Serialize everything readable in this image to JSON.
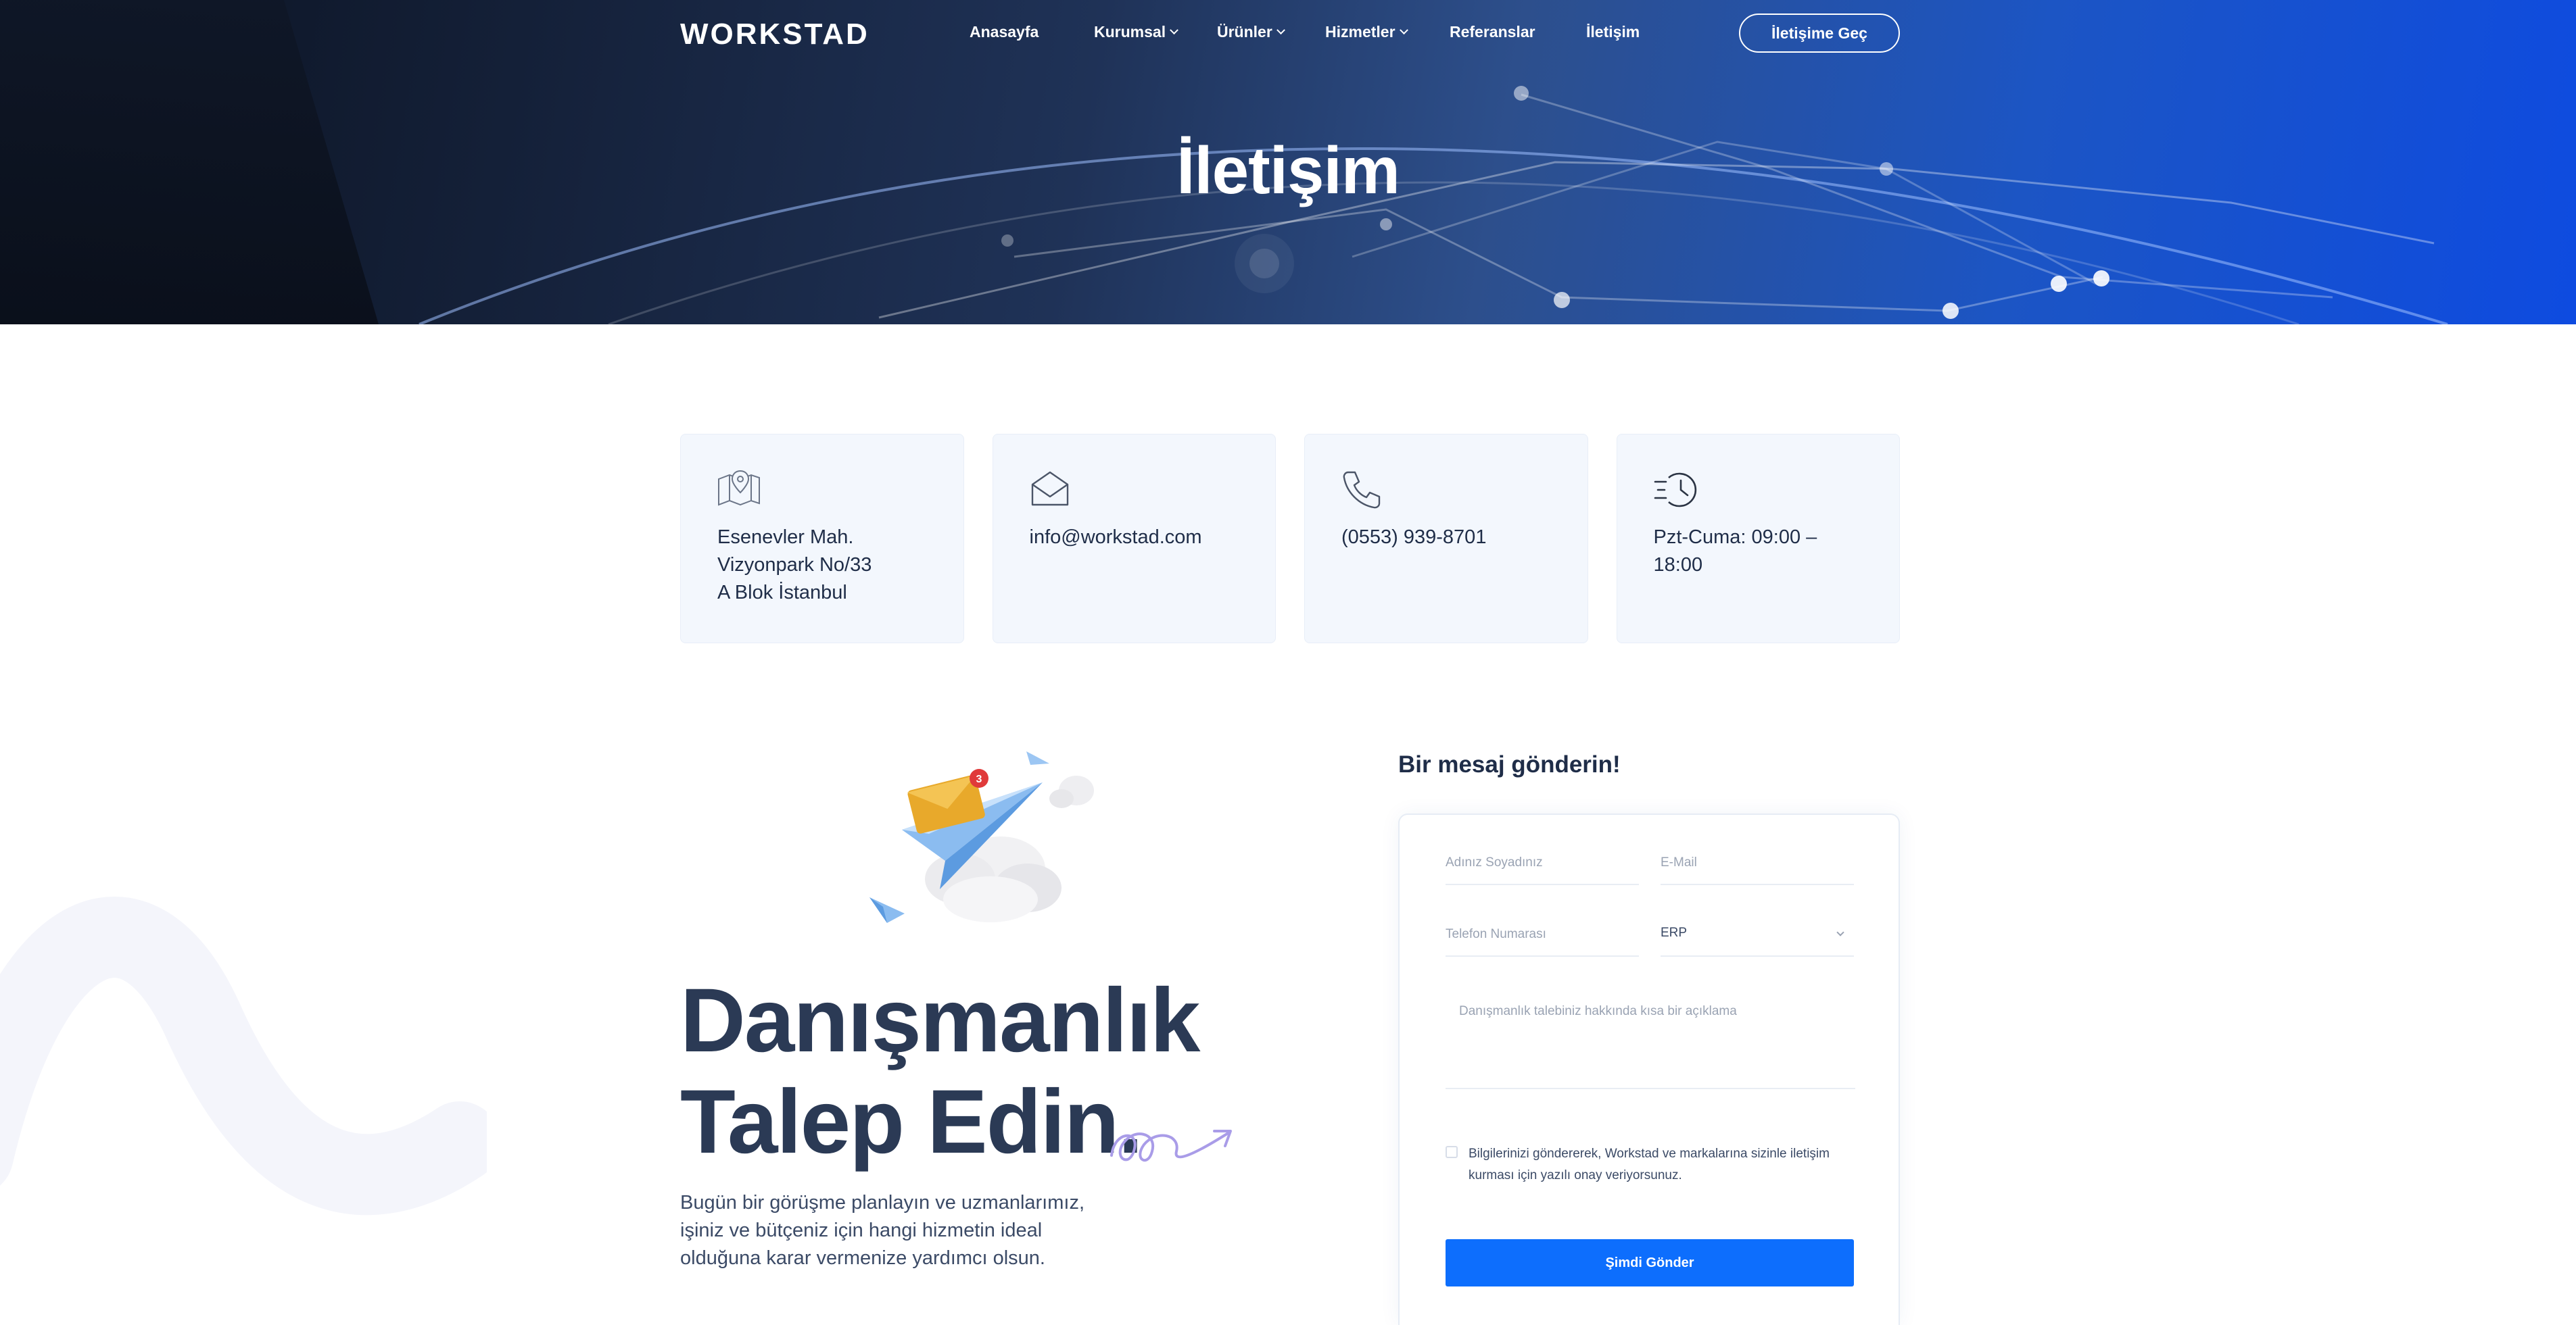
{
  "header": {
    "logo": "WORKSTAD",
    "nav": [
      {
        "label": "Anasayfa",
        "has_dropdown": false
      },
      {
        "label": "Kurumsal",
        "has_dropdown": true
      },
      {
        "label": "Ürünler",
        "has_dropdown": true
      },
      {
        "label": "Hizmetler",
        "has_dropdown": true
      },
      {
        "label": "Referanslar",
        "has_dropdown": false
      },
      {
        "label": "İletişim",
        "has_dropdown": false
      }
    ],
    "cta_label": "İletişime Geç"
  },
  "hero": {
    "title": "İletişim"
  },
  "contact_cards": [
    {
      "icon": "map-pin-icon",
      "text": "Esenevler Mah.\nVizyonpark No/33\nA Blok İstanbul"
    },
    {
      "icon": "envelope-icon",
      "text": "info@workstad.com"
    },
    {
      "icon": "phone-icon",
      "text": "(0553) 939-8701"
    },
    {
      "icon": "clock-icon",
      "text": "Pzt-Cuma: 09:00 –\n18:00"
    }
  ],
  "promo": {
    "title_line1": "Danışmanlık",
    "title_line2": "Talep Edin",
    "title_dot": ".",
    "description": "Bugün bir görüşme planlayın ve uzmanlarımız, işiniz ve bütçeniz için hangi hizmetin ideal olduğuna karar vermenize yardımcı olsun.",
    "illustration": "paper-plane-envelope-illustration",
    "badge_count": "3"
  },
  "form": {
    "title": "Bir mesaj gönderin!",
    "name_placeholder": "Adınız Soyadınız",
    "email_placeholder": "E-Mail",
    "phone_placeholder": "Telefon Numarası",
    "service_selected": "ERP",
    "message_placeholder": "Danışmanlık talebiniz hakkında kısa bir açıklama",
    "consent_text": "Bilgilerinizi göndererek, Workstad ve markalarına sizinle iletişim kurması için yazılı onay veriyorsunuz.",
    "submit_label": "Şimdi Gönder"
  },
  "colors": {
    "primary": "#0d6efd",
    "heading": "#2b3a55",
    "card_bg": "#f3f7fd"
  }
}
